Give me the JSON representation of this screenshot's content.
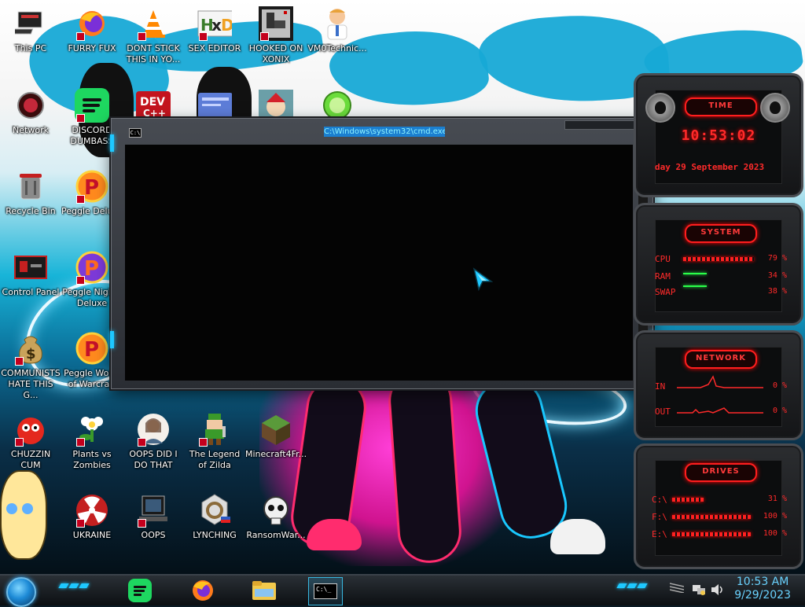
{
  "desktop": {
    "icons": [
      {
        "label": "This PC"
      },
      {
        "label": "FURRY FUX"
      },
      {
        "label": "DONT STICK THIS IN YO..."
      },
      {
        "label": "SEX EDITOR"
      },
      {
        "label": "HOOKED ON XONIX"
      },
      {
        "label": "VM0Technic..."
      },
      {
        "label": "Network"
      },
      {
        "label": "DISCORD DUMBASS"
      },
      {
        "label": "DEV C++"
      },
      {
        "label": "Recycle Bin"
      },
      {
        "label": "Peggle Deluxe"
      },
      {
        "label": "Control Panel"
      },
      {
        "label": "Peggle Nights Deluxe"
      },
      {
        "label": "COMMUNISTS HATE THIS G..."
      },
      {
        "label": "Peggle World of Warcraft"
      },
      {
        "label": "CHUZZIN CUM"
      },
      {
        "label": "Plants vs Zombies"
      },
      {
        "label": "OOPS DID I DO THAT"
      },
      {
        "label": "The Legend of Zilda"
      },
      {
        "label": "Minecraft4Fr..."
      },
      {
        "label": "UKRAINE"
      },
      {
        "label": "OOPS"
      },
      {
        "label": "LYNCHING"
      },
      {
        "label": "RansomWar..."
      }
    ]
  },
  "cmd_window": {
    "title": "C:\\Windows\\system32\\cmd.exe",
    "icon_text": "C:\\"
  },
  "gadgets": {
    "time": {
      "header": "TIME",
      "time": "10:53:02",
      "date": "day 29 September 2023"
    },
    "system": {
      "header": "SYSTEM",
      "rows": [
        {
          "label": "CPU",
          "value": "79 %",
          "level": 0.79
        },
        {
          "label": "RAM",
          "value": "34 %",
          "level": 0.34
        },
        {
          "label": "SWAP",
          "value": "38 %",
          "level": 0.38
        }
      ]
    },
    "network": {
      "header": "NETWORK",
      "rows": [
        {
          "label": "IN",
          "value": "0 %"
        },
        {
          "label": "OUT",
          "value": "0 %"
        }
      ]
    },
    "drives": {
      "header": "DRIVES",
      "rows": [
        {
          "label": "C:\\",
          "value": "31 %",
          "level": 0.31
        },
        {
          "label": "F:\\",
          "value": "100 %",
          "level": 1.0
        },
        {
          "label": "E:\\",
          "value": "100 %",
          "level": 1.0
        }
      ]
    }
  },
  "taskbar": {
    "cmd_label": "C:\\_",
    "clock_time": "10:53 AM",
    "clock_date": "9/29/2023"
  },
  "colors": {
    "accent": "#1ec8ff",
    "gadget_red": "#ff2a2a",
    "title_highlight": "#1b7fd0"
  }
}
